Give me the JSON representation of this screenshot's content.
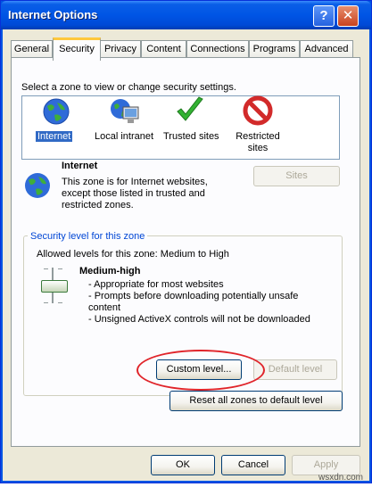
{
  "window": {
    "title": "Internet Options",
    "help_glyph": "?",
    "close_glyph": "✕"
  },
  "tabs": [
    {
      "label": "General"
    },
    {
      "label": "Security"
    },
    {
      "label": "Privacy"
    },
    {
      "label": "Content"
    },
    {
      "label": "Connections"
    },
    {
      "label": "Programs"
    },
    {
      "label": "Advanced"
    }
  ],
  "zones_prompt": "Select a zone to view or change security settings.",
  "zones": [
    {
      "label": "Internet",
      "icon": "globe-icon",
      "selected": true
    },
    {
      "label": "Local intranet",
      "icon": "intranet-icon"
    },
    {
      "label": "Trusted sites",
      "icon": "checkmark-icon"
    },
    {
      "label": "Restricted sites",
      "icon": "restricted-icon"
    }
  ],
  "zone_info": {
    "name": "Internet",
    "desc1": "This zone is for Internet websites,",
    "desc2": "except those listed in trusted and",
    "desc3": "restricted zones.",
    "sites_button": "Sites"
  },
  "security": {
    "group_title": "Security level for this zone",
    "allowed": "Allowed levels for this zone: Medium to High",
    "level_name": "Medium-high",
    "bullet1": "- Appropriate for most websites",
    "bullet2a": "- Prompts before downloading potentially unsafe",
    "bullet2b": "content",
    "bullet3": "- Unsigned ActiveX controls will not be downloaded",
    "custom_button": "Custom level...",
    "default_button": "Default level",
    "reset_button": "Reset all zones to default level"
  },
  "footer": {
    "ok": "OK",
    "cancel": "Cancel",
    "apply": "Apply"
  },
  "watermark": "wsxdn.com",
  "colors": {
    "title_bar": "#0055e5",
    "selection": "#316ac5",
    "highlight_oval": "#e0242a"
  }
}
